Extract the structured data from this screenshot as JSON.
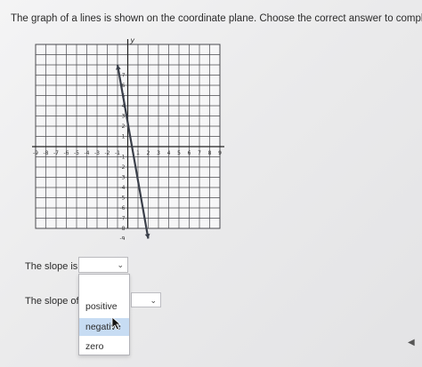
{
  "question": {
    "text": "The graph of a lines is shown on the coordinate plane. Choose the correct answer to compl"
  },
  "graph": {
    "x_axis_label": "x",
    "y_axis_label": "y",
    "x_tick_labels": [
      "-9",
      "-8",
      "-7",
      "-6",
      "-5",
      "-4",
      "-3",
      "-2",
      "-1",
      "1",
      "2",
      "3",
      "4",
      "5",
      "6",
      "7",
      "8",
      "9"
    ],
    "y_tick_labels_pos": [
      "7",
      "6",
      "5",
      "4",
      "3",
      "2",
      "1"
    ],
    "y_tick_labels_neg": [
      "-1",
      "-2",
      "-3",
      "-4",
      "-5",
      "-6",
      "-7",
      "-8",
      "-9"
    ],
    "line": {
      "from": [
        -1,
        8
      ],
      "to": [
        2,
        -9
      ],
      "color": "#3a3f4a"
    },
    "grid_color": "#4a4a4f"
  },
  "prompts": {
    "slope_is": "The slope is",
    "slope_of": "The slope of"
  },
  "dropdown_menu": {
    "options": [
      "positive",
      "negative",
      "zero"
    ],
    "highlighted_index": 1,
    "highlight_color": "#c7dcf3"
  },
  "icons": {
    "chevron": "chevron-down-icon",
    "cursor": "mouse-pointer-icon",
    "back": "left-arrow-icon"
  },
  "glyphs": {
    "chevron": "⌄",
    "back": "◀"
  }
}
